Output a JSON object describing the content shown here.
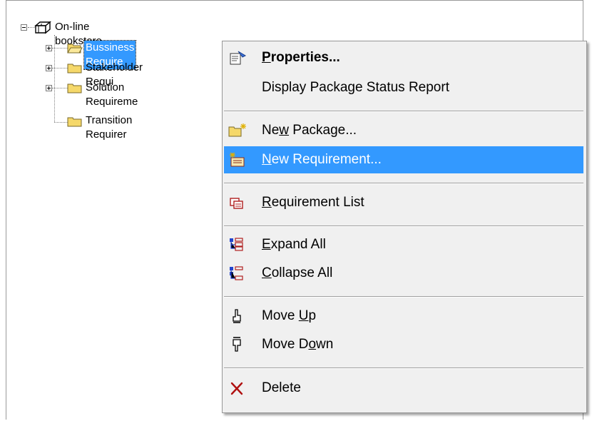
{
  "tree": {
    "root": "On-line bookstore",
    "children": [
      {
        "label": "Bussiness Require",
        "expandable": true,
        "selected": true
      },
      {
        "label": "Stakeholder Requi",
        "expandable": true,
        "selected": false
      },
      {
        "label": "Solution Requireme",
        "expandable": true,
        "selected": false
      },
      {
        "label": "Transition Requirer",
        "expandable": false,
        "selected": false
      }
    ]
  },
  "menu": {
    "properties": {
      "pre": "",
      "mn": "P",
      "post": "roperties..."
    },
    "status_report": {
      "label": "Display Package Status Report"
    },
    "new_package": {
      "pre": "Ne",
      "mn": "w",
      "post": " Package..."
    },
    "new_requirement": {
      "pre": "",
      "mn": "N",
      "post": "ew Requirement..."
    },
    "requirement_list": {
      "pre": "",
      "mn": "R",
      "post": "equirement List"
    },
    "expand_all": {
      "pre": "",
      "mn": "E",
      "post": "xpand All"
    },
    "collapse_all": {
      "pre": "",
      "mn": "C",
      "post": "ollapse All"
    },
    "move_up": {
      "pre": "Move ",
      "mn": "U",
      "post": "p"
    },
    "move_down": {
      "pre": "Move D",
      "mn": "o",
      "post": "wn"
    },
    "delete": {
      "label": "Delete"
    }
  },
  "colors": {
    "highlight": "#3399ff",
    "menu_bg": "#f0f0f0",
    "folder": "#f5d86a"
  }
}
